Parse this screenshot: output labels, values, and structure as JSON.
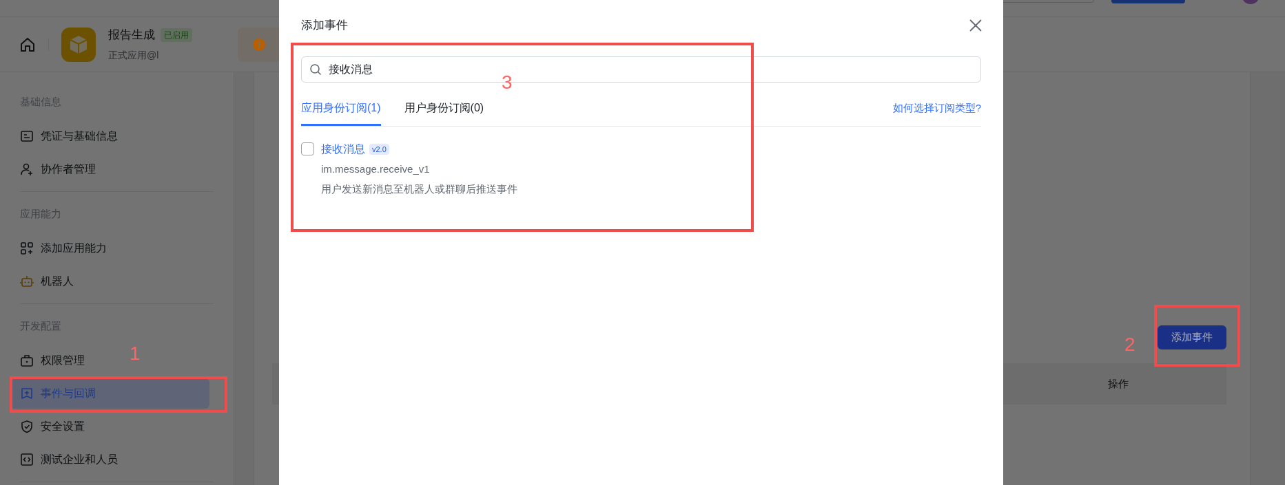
{
  "app_header": {
    "app_name": "报告生成",
    "status_badge": "已启用",
    "subtitle": "正式应用@l"
  },
  "sidebar": {
    "sections": [
      {
        "title": "基础信息",
        "items": [
          {
            "label": "凭证与基础信息",
            "selected": false
          },
          {
            "label": "协作者管理",
            "selected": false
          }
        ]
      },
      {
        "title": "应用能力",
        "items": [
          {
            "label": "添加应用能力",
            "selected": false
          },
          {
            "label": "机器人",
            "selected": false
          }
        ]
      },
      {
        "title": "开发配置",
        "items": [
          {
            "label": "权限管理",
            "selected": false
          },
          {
            "label": "事件与回调",
            "selected": true
          },
          {
            "label": "安全设置",
            "selected": false
          },
          {
            "label": "测试企业和人员",
            "selected": false
          }
        ]
      }
    ]
  },
  "content": {
    "add_button": "添加事件",
    "table": {
      "columns": [
        "操作"
      ]
    }
  },
  "modal": {
    "title": "添加事件",
    "search": {
      "value": "接收消息"
    },
    "tabs": [
      {
        "label": "应用身份订阅(1)",
        "selected": true
      },
      {
        "label": "用户身份订阅(0)",
        "selected": false
      }
    ],
    "help_link": "如何选择订阅类型?",
    "events": [
      {
        "name": "接收消息",
        "version": "v2.0",
        "code": "im.message.receive_v1",
        "description": "用户发送新消息至机器人或群聊后推送事件",
        "checked": false
      }
    ]
  },
  "annotations": [
    {
      "label": "1"
    },
    {
      "label": "2"
    },
    {
      "label": "3"
    }
  ]
}
